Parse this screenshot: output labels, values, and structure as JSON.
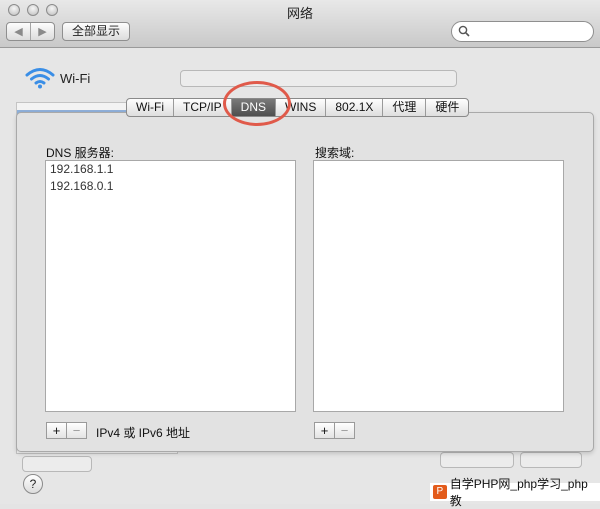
{
  "window": {
    "title": "网络"
  },
  "toolbar": {
    "back": "◀",
    "forward": "▶",
    "show_all_label": "全部显示",
    "search_placeholder": ""
  },
  "interface": {
    "name": "Wi-Fi"
  },
  "tabs": [
    {
      "label": "Wi-Fi",
      "selected": false
    },
    {
      "label": "TCP/IP",
      "selected": false
    },
    {
      "label": "DNS",
      "selected": true
    },
    {
      "label": "WINS",
      "selected": false
    },
    {
      "label": "802.1X",
      "selected": false
    },
    {
      "label": "代理",
      "selected": false
    },
    {
      "label": "硬件",
      "selected": false
    }
  ],
  "dns": {
    "servers_label": "DNS 服务器:",
    "servers": [
      "192.168.1.1",
      "192.168.0.1"
    ],
    "hint": "IPv4 或 IPv6 地址",
    "search_domains_label": "搜索域:",
    "search_domains": []
  },
  "buttons": {
    "add": "+",
    "remove": "−",
    "help": "?"
  },
  "watermark": {
    "text": "自学PHP网_php学习_php教"
  }
}
